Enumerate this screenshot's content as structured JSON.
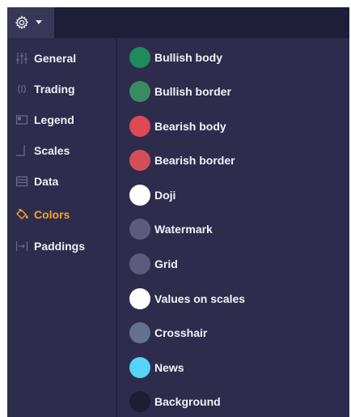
{
  "toolbar": {
    "settings_icon": "gear-icon",
    "dropdown_icon": "caret-down-icon"
  },
  "sidebar": {
    "active_color": "#f5a623",
    "items": [
      {
        "label": "General",
        "icon": "sliders-icon",
        "active": false
      },
      {
        "label": "Trading",
        "icon": "trading-icon",
        "active": false
      },
      {
        "label": "Legend",
        "icon": "legend-icon",
        "active": false
      },
      {
        "label": "Scales",
        "icon": "scales-icon",
        "active": false
      },
      {
        "label": "Data",
        "icon": "data-icon",
        "active": false
      },
      {
        "label": "Colors",
        "icon": "paint-bucket-icon",
        "active": true
      },
      {
        "label": "Paddings",
        "icon": "paddings-icon",
        "active": false
      }
    ]
  },
  "colors": {
    "items": [
      {
        "label": "Bullish body",
        "color": "#1e8a5e"
      },
      {
        "label": "Bullish border",
        "color": "#3a8a62"
      },
      {
        "label": "Bearish body",
        "color": "#dc4a56"
      },
      {
        "label": "Bearish border",
        "color": "#d24f58"
      },
      {
        "label": "Doji",
        "color": "#ffffff"
      },
      {
        "label": "Watermark",
        "color": "#5c5b7d"
      },
      {
        "label": "Grid",
        "color": "#5c5b7d"
      },
      {
        "label": "Values on scales",
        "color": "#ffffff"
      },
      {
        "label": "Crosshair",
        "color": "#62728f"
      },
      {
        "label": "News",
        "color": "#56d4f7"
      },
      {
        "label": "Background",
        "color": "#1e1d36"
      }
    ]
  }
}
